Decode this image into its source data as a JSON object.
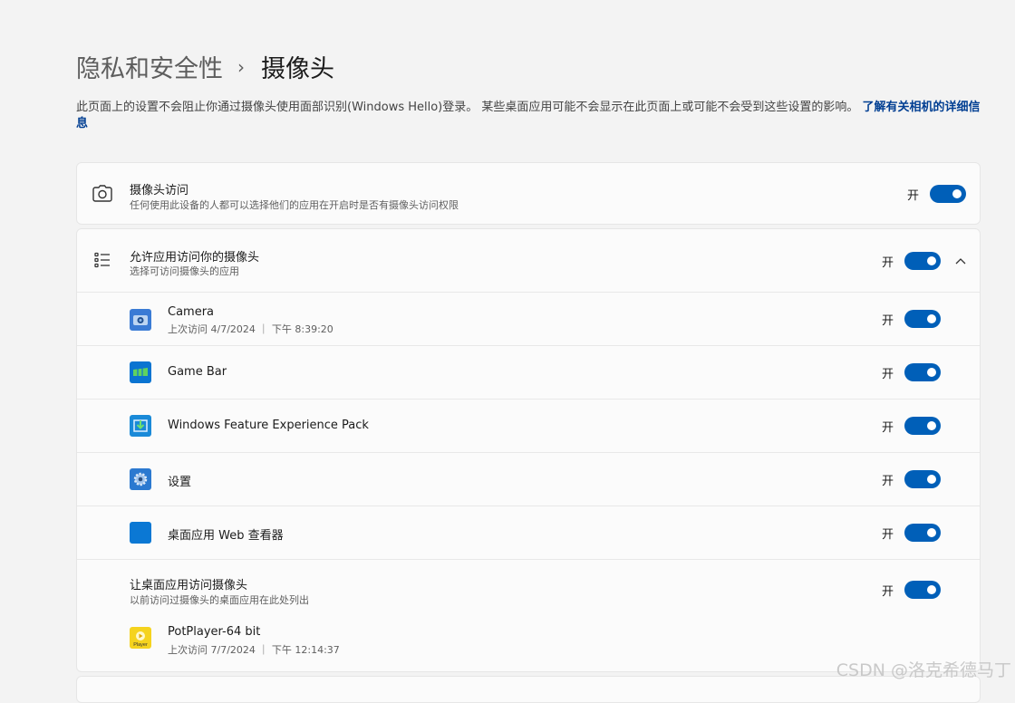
{
  "breadcrumb": {
    "parent": "隐私和安全性",
    "separator": "›",
    "current": "摄像头"
  },
  "description": {
    "text": "此页面上的设置不会阻止你通过摄像头使用面部识别(Windows Hello)登录。 某些桌面应用可能不会显示在此页面上或可能不会受到这些设置的影响。 ",
    "link": "了解有关相机的详细信息"
  },
  "camera_access": {
    "title": "摄像头访问",
    "subtitle": "任何使用此设备的人都可以选择他们的应用在开启时是否有摄像头访问权限",
    "state": "开",
    "icon": "camera-icon"
  },
  "allow_apps": {
    "title": "允许应用访问你的摄像头",
    "subtitle": "选择可访问摄像头的应用",
    "state": "开",
    "icon": "list-icon",
    "apps": [
      {
        "name": "Camera",
        "last": "上次访问 4/7/2024 ｜ 下午 8:39:20",
        "state": "开",
        "icon": "camera-app-icon",
        "color": "#3a7bd5"
      },
      {
        "name": "Game Bar",
        "last": "",
        "state": "开",
        "icon": "game-bar-icon",
        "color": "#0a74d1"
      },
      {
        "name": "Windows Feature Experience Pack",
        "last": "",
        "state": "开",
        "icon": "feature-pack-icon",
        "color": "#1a8ad8"
      },
      {
        "name": "设置",
        "last": "",
        "state": "开",
        "icon": "settings-gear-icon",
        "color": "#2b79d0"
      },
      {
        "name": "桌面应用 Web 查看器",
        "last": "",
        "state": "开",
        "icon": "web-viewer-icon",
        "color": "#0b78d4"
      }
    ]
  },
  "desktop_apps": {
    "title": "让桌面应用访问摄像头",
    "subtitle": "以前访问过摄像头的桌面应用在此处列出",
    "state": "开",
    "apps": [
      {
        "name": "PotPlayer-64 bit",
        "last": "上次访问 7/7/2024 ｜ 下午 12:14:37",
        "icon": "potplayer-icon",
        "badge": "Player"
      }
    ]
  },
  "watermark": "CSDN @洛克希德马丁"
}
